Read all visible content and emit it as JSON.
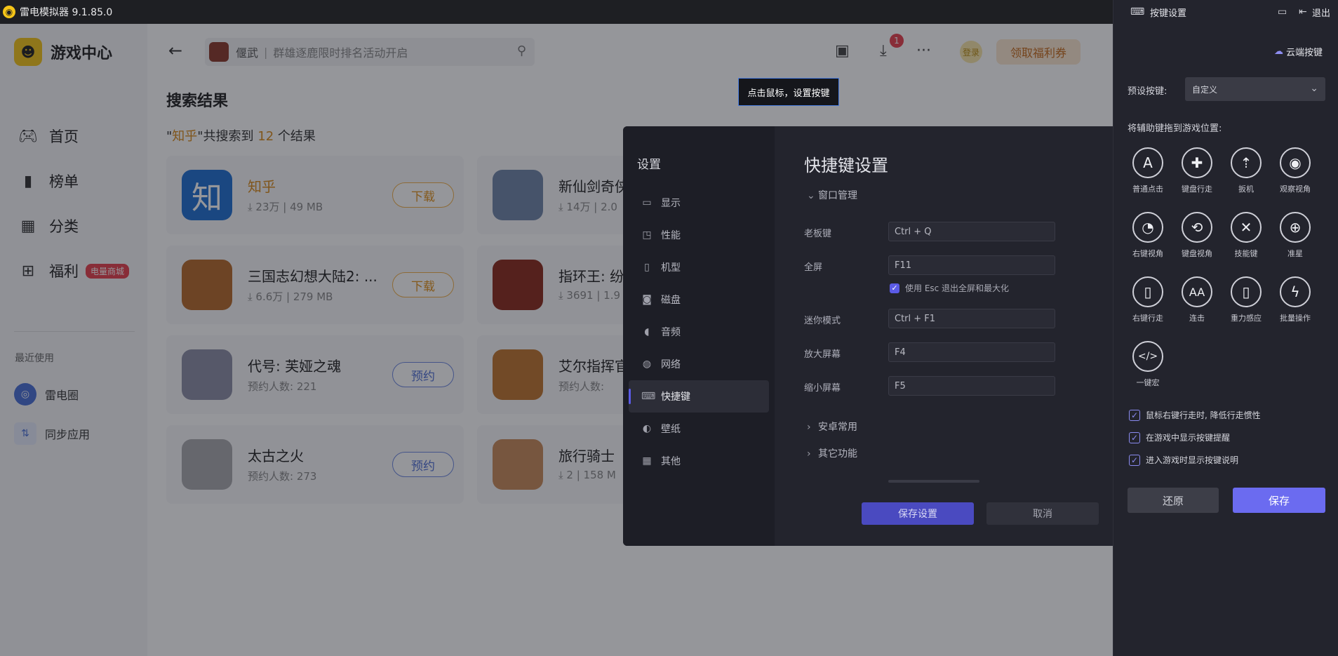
{
  "titlebar": {
    "app_title": "雷电模拟器 9.1.85.0"
  },
  "sidebar": {
    "brand": "游戏中心",
    "nav": [
      {
        "label": "首页",
        "icon": "gamepad-icon"
      },
      {
        "label": "榜单",
        "icon": "ranking-icon"
      },
      {
        "label": "分类",
        "icon": "category-icon"
      },
      {
        "label": "福利",
        "icon": "gift-icon",
        "badge": "电量商城"
      }
    ],
    "recent_title": "最近使用",
    "recent": [
      {
        "label": "雷电圈"
      },
      {
        "label": "同步应用"
      }
    ]
  },
  "topbar": {
    "search_game": "偃武",
    "search_hint": "群雄逐鹿限时排名活动开启",
    "download_badge": "1",
    "login": "登录",
    "coupon": "领取福利券"
  },
  "results": {
    "title": "搜索结果",
    "count_prefix": "\"",
    "keyword": "知乎",
    "count_mid": "\"共搜索到 ",
    "count": "12",
    "count_suffix": " 个结果",
    "cards": [
      {
        "name": "知乎",
        "meta": "⤓ 23万 | 49 MB",
        "button": "下载",
        "thumb": "知"
      },
      {
        "name": "新仙剑奇侠",
        "meta": "⤓ 14万 | 2.0"
      },
      {
        "name": "三国志幻想大陆2: ...",
        "meta": "⤓ 6.6万 | 279 MB",
        "button": "下载"
      },
      {
        "name": "指环王: 纷",
        "meta": "⤓ 3691 | 1.9"
      },
      {
        "name": "代号: 芙娅之魂",
        "meta": "预约人数: 221",
        "button": "预约"
      },
      {
        "name": "艾尔指挥官",
        "meta": "预约人数:"
      },
      {
        "name": "太古之火",
        "meta": "预约人数: 273",
        "button": "预约"
      },
      {
        "name": "旅行骑士",
        "meta": "⤓ 2 | 158 M"
      }
    ]
  },
  "tooltip": "点击鼠标，设置按键",
  "settings": {
    "title": "设置",
    "menu": [
      {
        "label": "显示",
        "icon": "monitor-icon"
      },
      {
        "label": "性能",
        "icon": "performance-icon"
      },
      {
        "label": "机型",
        "icon": "phone-model-icon"
      },
      {
        "label": "磁盘",
        "icon": "disk-icon"
      },
      {
        "label": "音频",
        "icon": "audio-icon"
      },
      {
        "label": "网络",
        "icon": "globe-icon"
      },
      {
        "label": "快捷键",
        "icon": "keyboard-icon"
      },
      {
        "label": "壁纸",
        "icon": "palette-icon"
      },
      {
        "label": "其他",
        "icon": "grid-icon"
      }
    ],
    "heading": "快捷键设置",
    "section_window": "窗口管理",
    "shortcuts": [
      {
        "label": "老板键",
        "value": "Ctrl + Q"
      },
      {
        "label": "全屏",
        "value": "F11"
      },
      {
        "label": "迷你模式",
        "value": "Ctrl + F1"
      },
      {
        "label": "放大屏幕",
        "value": "F4"
      },
      {
        "label": "缩小屏幕",
        "value": "F5"
      }
    ],
    "esc_option": "使用 Esc 退出全屏和最大化",
    "section_android": "安卓常用",
    "section_other": "其它功能",
    "save": "保存设置",
    "cancel": "取消"
  },
  "keypanel": {
    "title": "按键设置",
    "exit": "退出",
    "cloud": "云端按键",
    "preset_label": "预设按键:",
    "preset_value": "自定义",
    "drag_hint": "将辅助键拖到游戏位置:",
    "keys": [
      {
        "label": "普通点击",
        "icon": "letter-a-icon"
      },
      {
        "label": "键盘行走",
        "icon": "dpad-icon"
      },
      {
        "label": "扳机",
        "icon": "trigger-icon"
      },
      {
        "label": "观察视角",
        "icon": "eye-icon"
      },
      {
        "label": "右键视角",
        "icon": "right-mouse-view-icon"
      },
      {
        "label": "键盘视角",
        "icon": "keyboard-view-icon"
      },
      {
        "label": "技能键",
        "icon": "skill-icon"
      },
      {
        "label": "准星",
        "icon": "crosshair-icon"
      },
      {
        "label": "右键行走",
        "icon": "mouse-icon"
      },
      {
        "label": "连击",
        "icon": "combo-icon"
      },
      {
        "label": "重力感应",
        "icon": "gravity-icon"
      },
      {
        "label": "批量操作",
        "icon": "lightning-icon"
      },
      {
        "label": "一键宏",
        "icon": "macro-icon"
      }
    ],
    "options": [
      "鼠标右键行走时, 降低行走惯性",
      "在游戏中显示按键提醒",
      "进入游戏时显示按键说明"
    ],
    "restore": "还原",
    "save": "保存"
  }
}
